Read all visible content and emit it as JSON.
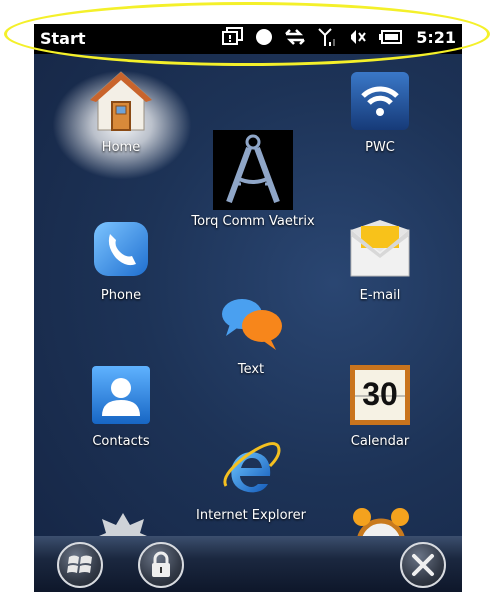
{
  "status_bar": {
    "title": "Start",
    "time": "5:21",
    "icons": [
      "notification-icon",
      "record-icon",
      "data-transfer-icon",
      "signal-icon",
      "speaker-muted-icon",
      "battery-icon"
    ]
  },
  "tiles": [
    {
      "label": "Home",
      "icon": "home-icon"
    },
    {
      "label": "PWC",
      "icon": "wifi-icon"
    },
    {
      "label": "Torq Comm Vaetrix",
      "icon": "compass-icon"
    },
    {
      "label": "Phone",
      "icon": "phone-icon"
    },
    {
      "label": "E-mail",
      "icon": "envelope-icon"
    },
    {
      "label": "Text",
      "icon": "chat-bubbles-icon"
    },
    {
      "label": "Contacts",
      "icon": "contact-card-icon"
    },
    {
      "label": "Calendar",
      "icon": "calendar-icon",
      "day": "30"
    },
    {
      "label": "Internet Explorer",
      "icon": "internet-explorer-icon"
    }
  ],
  "bottom_bar": {
    "buttons": [
      "windows-start-icon",
      "lock-icon",
      "close-icon"
    ]
  },
  "colors": {
    "highlight": "#f4f02a",
    "background": "#1d3357",
    "status_bar": "#000000"
  }
}
